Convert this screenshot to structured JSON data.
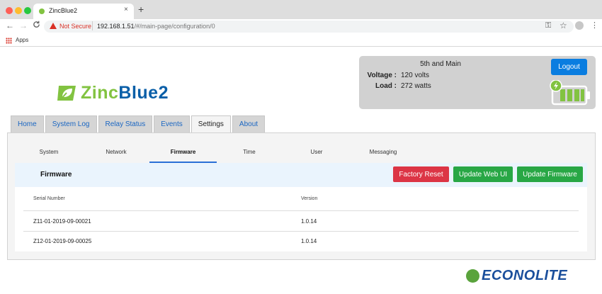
{
  "browser": {
    "tab_title": "ZincBlue2",
    "tab_close": "×",
    "new_tab": "+",
    "nav_back": "←",
    "nav_forward": "→",
    "nav_reload": "C",
    "security_label": "Not Secure",
    "url_host": "192.168.1.51",
    "url_path": "/#/main-page/configuration/0",
    "key_glyph": "⚿",
    "star_glyph": "☆",
    "menu_glyph": "⋮",
    "bookmarks": {
      "apps_label": "Apps"
    }
  },
  "brand": {
    "logo_part1": "Zinc",
    "logo_part2": "Blue2",
    "logo_colors": {
      "zinc": "#82c341",
      "blue": "#0a5fa8"
    },
    "footer_logo": "ECONOLITE"
  },
  "status": {
    "site_name": "5th and Main",
    "voltage_label": "Voltage :",
    "voltage_value": "120 volts",
    "load_label": "Load :",
    "load_value": "272 watts",
    "logout_label": "Logout",
    "battery_icon": "battery-charging-icon"
  },
  "main_tabs": [
    {
      "label": "Home"
    },
    {
      "label": "System Log"
    },
    {
      "label": "Relay Status"
    },
    {
      "label": "Events"
    },
    {
      "label": "Settings",
      "active": true
    },
    {
      "label": "About"
    }
  ],
  "settings": {
    "sub_tabs": [
      {
        "label": "System"
      },
      {
        "label": "Network"
      },
      {
        "label": "Firmware",
        "active": true
      },
      {
        "label": "Time"
      },
      {
        "label": "User"
      },
      {
        "label": "Messaging"
      }
    ],
    "firmware": {
      "title": "Firmware",
      "buttons": {
        "factory_reset": "Factory Reset",
        "update_web_ui": "Update Web UI",
        "update_firmware": "Update Firmware"
      },
      "columns": {
        "serial": "Serial Number",
        "version": "Version"
      },
      "rows": [
        {
          "serial": "Z11-01-2019-09-00021",
          "version": "1.0.14"
        },
        {
          "serial": "Z12-01-2019-09-00025",
          "version": "1.0.14"
        }
      ]
    }
  },
  "colors": {
    "primary": "#0a7de0",
    "danger": "#dc3545",
    "success": "#28a745",
    "tab_link": "#1a66c2"
  }
}
